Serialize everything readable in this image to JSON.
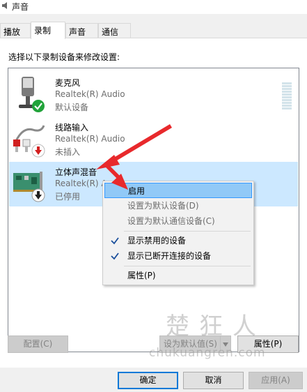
{
  "window": {
    "title": "声音"
  },
  "tabs": [
    {
      "label": "播放"
    },
    {
      "label": "录制"
    },
    {
      "label": "声音"
    },
    {
      "label": "通信"
    }
  ],
  "active_tab": "录制",
  "instruction": "选择以下录制设备来修改设置:",
  "devices": [
    {
      "name": "麦克风",
      "driver": "Realtek(R) Audio",
      "status": "默认设备",
      "icon": "microphone-icon",
      "badge": "green-check-badge"
    },
    {
      "name": "线路输入",
      "driver": "Realtek(R) Audio",
      "status": "未插入",
      "icon": "line-in-cable-icon",
      "badge": "red-down-arrow-badge"
    },
    {
      "name": "立体声混音",
      "driver": "Realtek(R) A",
      "status": "已停用",
      "icon": "sound-card-icon",
      "badge": "black-down-arrow-badge",
      "selected": true
    }
  ],
  "context_menu": {
    "items": [
      {
        "label": "启用",
        "highlighted": true,
        "enabled": true
      },
      {
        "label": "设置为默认设备(D)",
        "enabled": false
      },
      {
        "label": "设置为默认通信设备(C)",
        "enabled": false
      },
      {
        "label": "显示禁用的设备",
        "checked": true,
        "enabled": true
      },
      {
        "label": "显示已断开连接的设备",
        "checked": true,
        "enabled": true
      },
      {
        "label": "属性(P)",
        "enabled": true
      }
    ]
  },
  "buttons": {
    "configure": "配置(C)",
    "set_default": "设为默认值(S)",
    "properties": "属性(P)",
    "ok": "确定",
    "cancel": "取消",
    "apply": "应用(A)"
  },
  "watermark": {
    "text": "楚狂人",
    "url": "chukuangren.com"
  },
  "colors": {
    "selection": "#cce8ff",
    "menu_highlight": "#91c9f7",
    "arrow": "#e8292c",
    "primary_border": "#0078d7"
  }
}
